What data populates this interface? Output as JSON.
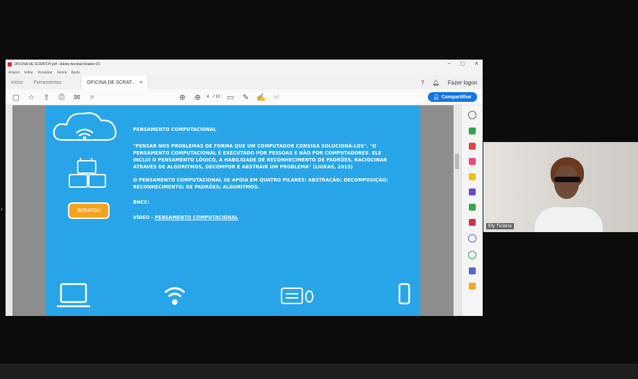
{
  "window": {
    "title": "OFICINA DE SCRATCH.pdf - Adobe Acrobat Reader DC",
    "controls": [
      "–",
      "▢",
      "✕"
    ]
  },
  "menu": [
    "Arquivo",
    "Editar",
    "Visualizar",
    "Janela",
    "Ajuda"
  ],
  "tabs": {
    "home": "Início",
    "tools": "Ferramentas",
    "doc": "OFICINA DE SCRAT...",
    "login": "Fazer logon"
  },
  "toolbar": {
    "page": "4",
    "page_total": "/ 10",
    "share": "Compartilhar"
  },
  "slide": {
    "heading": "PENSAMENTO COMPUTACIONAL",
    "quote": "\"PENSAR NOS PROBLEMAS DE FORMA QUE UM COMPUTADOR CONSIGA SOLUCIONÁ-LOS\". \"O PENSAMENTO COMPUTACIONAL É EXECUTADO POR PESSOAS E NÃO POR COMPUTADORES. ELE INCLUI O PENSAMENTO LÓGICO, A HABILIDADE DE RECONHECIMENTO DE PADRÕES, RACIOCINAR ATRAVÉS DE ALGORITMOS, DECOMPOR E ABSTRAIR UM PROBLEMA\" (LIUKAS, 2015)",
    "pillars": "O PENSAMENTO COMPUTACIONAL SE APOIA EM QUATRO PILARES: ABSTRAÇÃO; DECOMPOSIÇÃO; RECONHECIMENTO; DE PADRÕES; ALGORITMOS.",
    "bncc": "BNCC:",
    "video_prefix": "VÍDEO - ",
    "video_link": "PENSAMENTO COMPUTACIONAL",
    "logo": "SCRATCH"
  },
  "participant": {
    "name": "Ely Ticiana"
  },
  "colors": {
    "slide_bg": "#28a5e8",
    "share_btn": "#1473e6"
  }
}
